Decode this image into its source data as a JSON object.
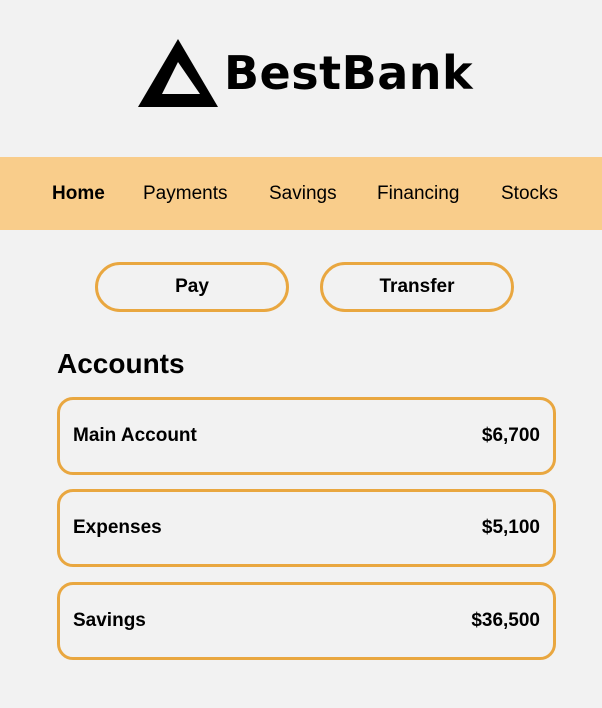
{
  "brand": {
    "name": "BestBank",
    "logo_icon": "triangle-logo-icon"
  },
  "nav": {
    "items": [
      {
        "label": "Home",
        "active": true
      },
      {
        "label": "Payments",
        "active": false
      },
      {
        "label": "Savings",
        "active": false
      },
      {
        "label": "Financing",
        "active": false
      },
      {
        "label": "Stocks",
        "active": false
      }
    ]
  },
  "actions": {
    "pay_label": "Pay",
    "transfer_label": "Transfer"
  },
  "accounts": {
    "title": "Accounts",
    "items": [
      {
        "name": "Main Account",
        "balance": "$6,700"
      },
      {
        "name": "Expenses",
        "balance": "$5,100"
      },
      {
        "name": "Savings",
        "balance": "$36,500"
      }
    ]
  },
  "colors": {
    "background": "#f2f2f2",
    "nav_background": "#f9cd8b",
    "accent_border": "#e9a740",
    "text": "#000000"
  }
}
